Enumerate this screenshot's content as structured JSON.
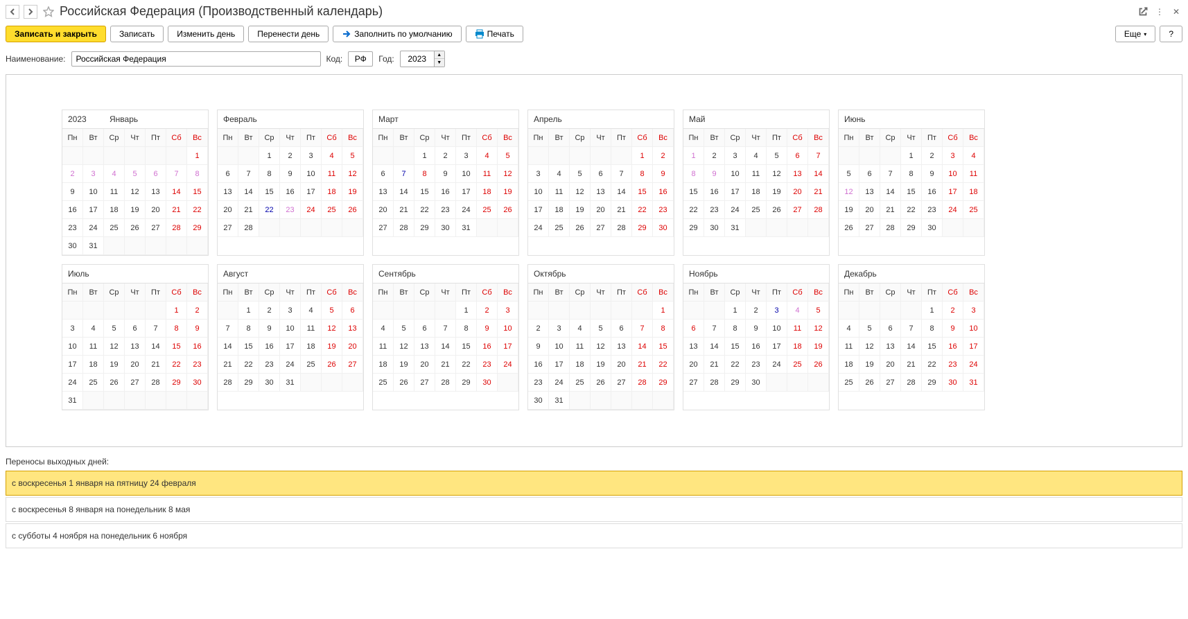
{
  "title": "Российская Федерация (Производственный календарь)",
  "toolbar": {
    "save_close": "Записать и закрыть",
    "save": "Записать",
    "change_day": "Изменить день",
    "move_day": "Перенести день",
    "fill_default": "Заполнить по умолчанию",
    "print": "Печать",
    "more": "Еще",
    "help": "?"
  },
  "fields": {
    "name_label": "Наименование:",
    "name_value": "Российская Федерация",
    "code_label": "Код:",
    "code_value": "РФ",
    "year_label": "Год:",
    "year_value": "2023"
  },
  "year": "2023",
  "dow": [
    "Пн",
    "Вт",
    "Ср",
    "Чт",
    "Пт",
    "Сб",
    "Вс"
  ],
  "months": [
    {
      "name": "Январь",
      "first": 6,
      "days": 31,
      "hol": [
        1,
        2,
        3,
        4,
        5,
        6,
        7,
        8,
        14,
        15,
        21,
        22,
        28,
        29
      ],
      "pre": [],
      "ext": [
        2,
        3,
        4,
        5,
        6,
        7,
        8
      ]
    },
    {
      "name": "Февраль",
      "first": 2,
      "days": 28,
      "hol": [
        4,
        5,
        11,
        12,
        18,
        19,
        24,
        25,
        26
      ],
      "pre": [
        22
      ],
      "ext": [
        23
      ]
    },
    {
      "name": "Март",
      "first": 2,
      "days": 31,
      "hol": [
        4,
        5,
        8,
        11,
        12,
        18,
        19,
        25,
        26
      ],
      "pre": [
        7
      ],
      "ext": []
    },
    {
      "name": "Апрель",
      "first": 5,
      "days": 30,
      "hol": [
        1,
        2,
        8,
        9,
        15,
        16,
        22,
        23,
        29,
        30
      ],
      "pre": [],
      "ext": []
    },
    {
      "name": "Май",
      "first": 0,
      "days": 31,
      "hol": [
        1,
        6,
        7,
        8,
        9,
        13,
        14,
        20,
        21,
        27,
        28
      ],
      "pre": [],
      "ext": [
        1,
        8,
        9
      ]
    },
    {
      "name": "Июнь",
      "first": 3,
      "days": 30,
      "hol": [
        3,
        4,
        10,
        11,
        12,
        17,
        18,
        24,
        25
      ],
      "pre": [],
      "ext": [
        12
      ]
    },
    {
      "name": "Июль",
      "first": 5,
      "days": 31,
      "hol": [
        1,
        2,
        8,
        9,
        15,
        16,
        22,
        23,
        29,
        30
      ],
      "pre": [],
      "ext": []
    },
    {
      "name": "Август",
      "first": 1,
      "days": 31,
      "hol": [
        5,
        6,
        12,
        13,
        19,
        20,
        26,
        27
      ],
      "pre": [],
      "ext": []
    },
    {
      "name": "Сентябрь",
      "first": 4,
      "days": 30,
      "hol": [
        2,
        3,
        9,
        10,
        16,
        17,
        23,
        24,
        30
      ],
      "pre": [],
      "ext": []
    },
    {
      "name": "Октябрь",
      "first": 6,
      "days": 31,
      "hol": [
        1,
        7,
        8,
        14,
        15,
        21,
        22,
        28,
        29
      ],
      "pre": [],
      "ext": []
    },
    {
      "name": "Ноябрь",
      "first": 2,
      "days": 30,
      "hol": [
        4,
        5,
        6,
        11,
        12,
        18,
        19,
        25,
        26
      ],
      "pre": [
        3
      ],
      "ext": [
        4
      ]
    },
    {
      "name": "Декабрь",
      "first": 4,
      "days": 31,
      "hol": [
        2,
        3,
        9,
        10,
        16,
        17,
        23,
        24,
        30,
        31
      ],
      "pre": [],
      "ext": []
    }
  ],
  "transfers": {
    "title": "Переносы выходных дней:",
    "rows": [
      {
        "text": "с воскресенья 1 января на пятницу 24 февраля",
        "sel": true
      },
      {
        "text": "с воскресенья 8 января на понедельник 8 мая",
        "sel": false
      },
      {
        "text": "с субботы 4 ноября на понедельник 6 ноября",
        "sel": false
      }
    ]
  }
}
